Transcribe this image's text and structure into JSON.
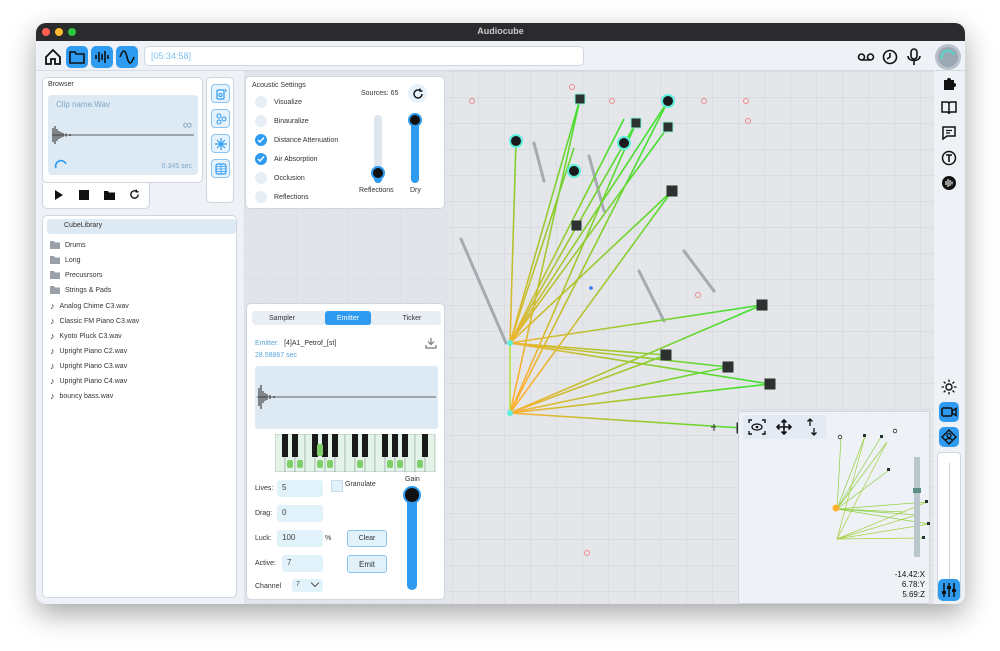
{
  "window": {
    "title": "Audiocube"
  },
  "toolbar": {
    "time_value": "[05:34:58]"
  },
  "browser": {
    "title": "Browser",
    "clip_name": "Clip name.Wav",
    "clip_duration": "0.345 sec",
    "infinity_symbol": "∞"
  },
  "library": {
    "header": "CubeLibrary",
    "folders": [
      "Drums",
      "Long",
      "Precusrsors",
      "Strings & Pads"
    ],
    "files": [
      "Analog Chime C3.wav",
      "Classic FM Piano C3.wav",
      "Kyoto Pluck C3.wav",
      "Upright Piano C2.wav",
      "Upright Piano C3.wav",
      "Upright Piano C4.wav",
      "bouncy bass.wav"
    ]
  },
  "acoustic": {
    "title": "Acoustic Settings",
    "sources_label": "Sources: 65",
    "options": [
      {
        "label": "Visualize",
        "checked": false
      },
      {
        "label": "Binauralize",
        "checked": false
      },
      {
        "label": "Distance Attenuation",
        "checked": true
      },
      {
        "label": "Air Absorption",
        "checked": true
      },
      {
        "label": "Occlusion",
        "checked": false
      },
      {
        "label": "Reflections",
        "checked": false
      }
    ],
    "reflections_label": "Reflections",
    "dry_label": "Dry",
    "reflections_level": 0.15,
    "dry_level": 0.95
  },
  "emitter_panel": {
    "tabs": [
      "Sampler",
      "Emitter",
      "Ticker"
    ],
    "active_tab": "Emitter",
    "emitter_label": "Emitter:",
    "emitter_name": "[4]A1_Petrof_[st]",
    "emitter_time": "28.58867 sec",
    "granulate_label": "Granulate",
    "gain_label": "Gain",
    "gain_level": 0.95,
    "lives_label": "Lives:",
    "lives_value": "5",
    "drag_label": "Drag:",
    "drag_value": "0",
    "luck_label": "Luck:",
    "luck_value": "100",
    "luck_unit": "%",
    "active_label": "Active:",
    "active_value": "7",
    "channel_label": "Channel",
    "channel_value": "7",
    "clear_label": "Clear",
    "emit_label": "Emit"
  },
  "minimap": {
    "x_readout": "-14.42:X",
    "y_readout": "6.78:Y",
    "z_readout": "5.69:Z"
  },
  "colors": {
    "accent": "#2e9bf0",
    "ray_start": "#ffb030",
    "ray_end": "#44e030"
  }
}
